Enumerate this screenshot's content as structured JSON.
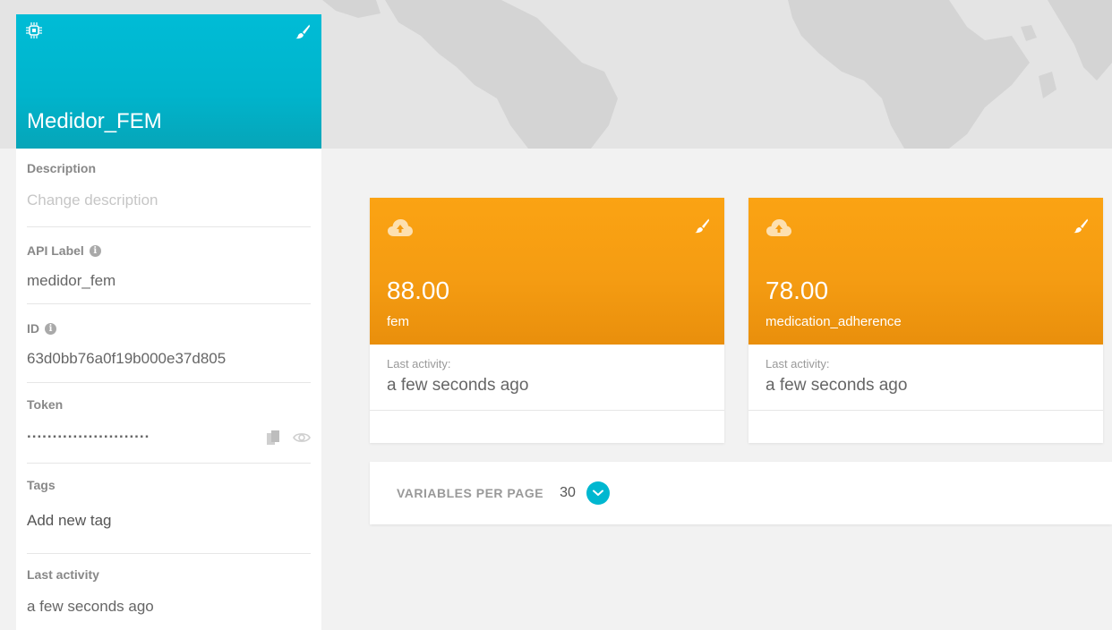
{
  "device": {
    "name": "Medidor_FEM",
    "description_label": "Description",
    "description_placeholder": "Change description",
    "api_label_label": "API Label",
    "api_label_value": "medidor_fem",
    "id_label": "ID",
    "id_value": "63d0bb76a0f19b000e37d805",
    "token_label": "Token",
    "token_value": "........................",
    "tags_label": "Tags",
    "tags_placeholder": "Add new tag",
    "last_activity_label": "Last activity",
    "last_activity_value": "a few seconds ago",
    "header_color": "#00bcd6"
  },
  "variables": [
    {
      "value": "88.00",
      "name": "fem",
      "last_activity_label": "Last activity:",
      "last_activity_value": "a few seconds ago",
      "icon": "cloud-upload-icon",
      "color": "#f9a010"
    },
    {
      "value": "78.00",
      "name": "medication_adherence",
      "last_activity_label": "Last activity:",
      "last_activity_value": "a few seconds ago",
      "icon": "cloud-upload-icon",
      "color": "#f9a010"
    }
  ],
  "pager": {
    "label": "VARIABLES PER PAGE",
    "value": "30"
  }
}
